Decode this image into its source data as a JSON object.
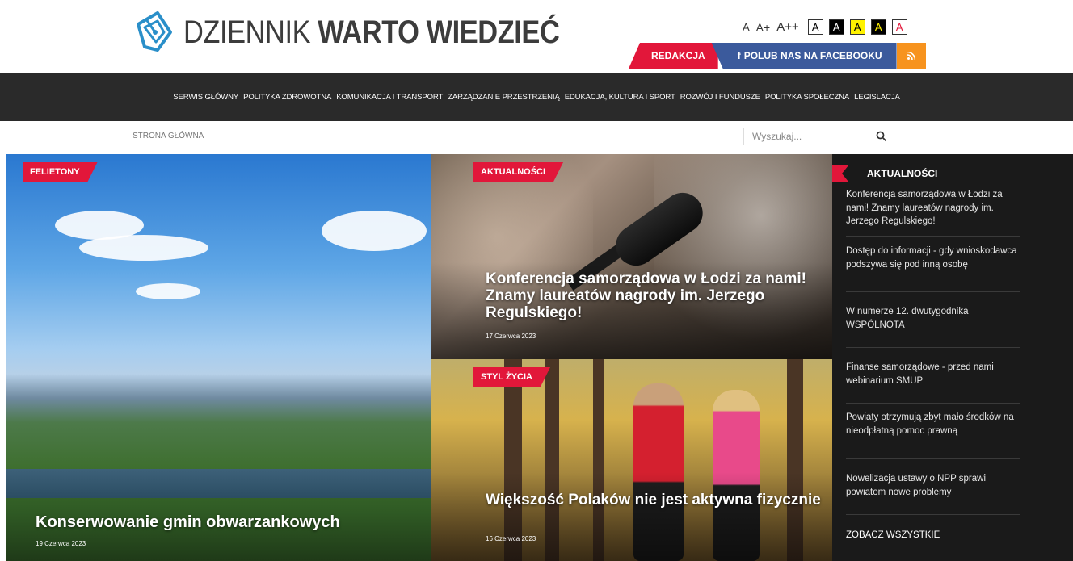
{
  "header": {
    "logo_light": "DZIENNIK",
    "logo_bold": "WARTO WIEDZIEĆ",
    "font_sizes": [
      "A",
      "A+",
      "A++"
    ],
    "contrast_buttons": [
      {
        "label": "A",
        "bg": "#ffffff",
        "fg": "#000000"
      },
      {
        "label": "A",
        "bg": "#000000",
        "fg": "#ffffff"
      },
      {
        "label": "A",
        "bg": "#fff200",
        "fg": "#000000"
      },
      {
        "label": "A",
        "bg": "#000000",
        "fg": "#fff200"
      },
      {
        "label": "A",
        "bg": "#ffffff",
        "fg": "#e2173a"
      }
    ],
    "redakcja_label": "REDAKCJA",
    "facebook_label": "POLUB NAS NA FACEBOOKU",
    "facebook_icon": "f",
    "rss_icon": "rss-icon"
  },
  "nav": {
    "items": [
      "SERWIS GŁÓWNY",
      "POLITYKA ZDROWOTNA",
      "KOMUNIKACJA I TRANSPORT",
      "ZARZĄDZANIE PRZESTRZENIĄ",
      "EDUKACJA, KULTURA I SPORT",
      "ROZWÓJ I FUNDUSZE",
      "POLITYKA SPOŁECZNA",
      "LEGISLACJA"
    ]
  },
  "subbar": {
    "breadcrumb": "STRONA GŁÓWNA",
    "search_placeholder": "Wyszukaj..."
  },
  "featured": [
    {
      "tag": "FELIETONY",
      "title": "Konserwowanie gmin obwarzankowych",
      "date": "19 Czerwca 2023"
    },
    {
      "tag": "AKTUALNOŚCI",
      "title": "Konferencja samorządowa w Łodzi za nami! Znamy laureatów nagrody im. Jerzego Regulskiego!",
      "date": "17 Czerwca 2023"
    },
    {
      "tag": "STYL ŻYCIA",
      "title": "Większość Polaków nie jest aktywna fizycznie",
      "date": "16 Czerwca 2023"
    }
  ],
  "sidebar": {
    "title": "AKTUALNOŚCI",
    "items": [
      "Konferencja samorządowa w Łodzi za nami! Znamy laureatów nagrody im. Jerzego Regulskiego!",
      "Dostęp do informacji - gdy wnioskodawca podszywa się pod inną osobę",
      "W numerze 12. dwutygodnika WSPÓLNOTA",
      "Finanse samorządowe - przed nami webinarium SMUP",
      "Powiaty otrzymują zbyt mało środków na nieodpłatną pomoc prawną",
      "Nowelizacja ustawy o NPP sprawi powiatom nowe problemy"
    ],
    "see_all": "ZOBACZ WSZYSTKIE"
  },
  "colors": {
    "accent_red": "#e2173a",
    "facebook_blue": "#3b5a9c",
    "rss_orange": "#f7931e",
    "nav_bg": "#2a2a2a",
    "sidebar_bg": "#1a1a1a"
  }
}
